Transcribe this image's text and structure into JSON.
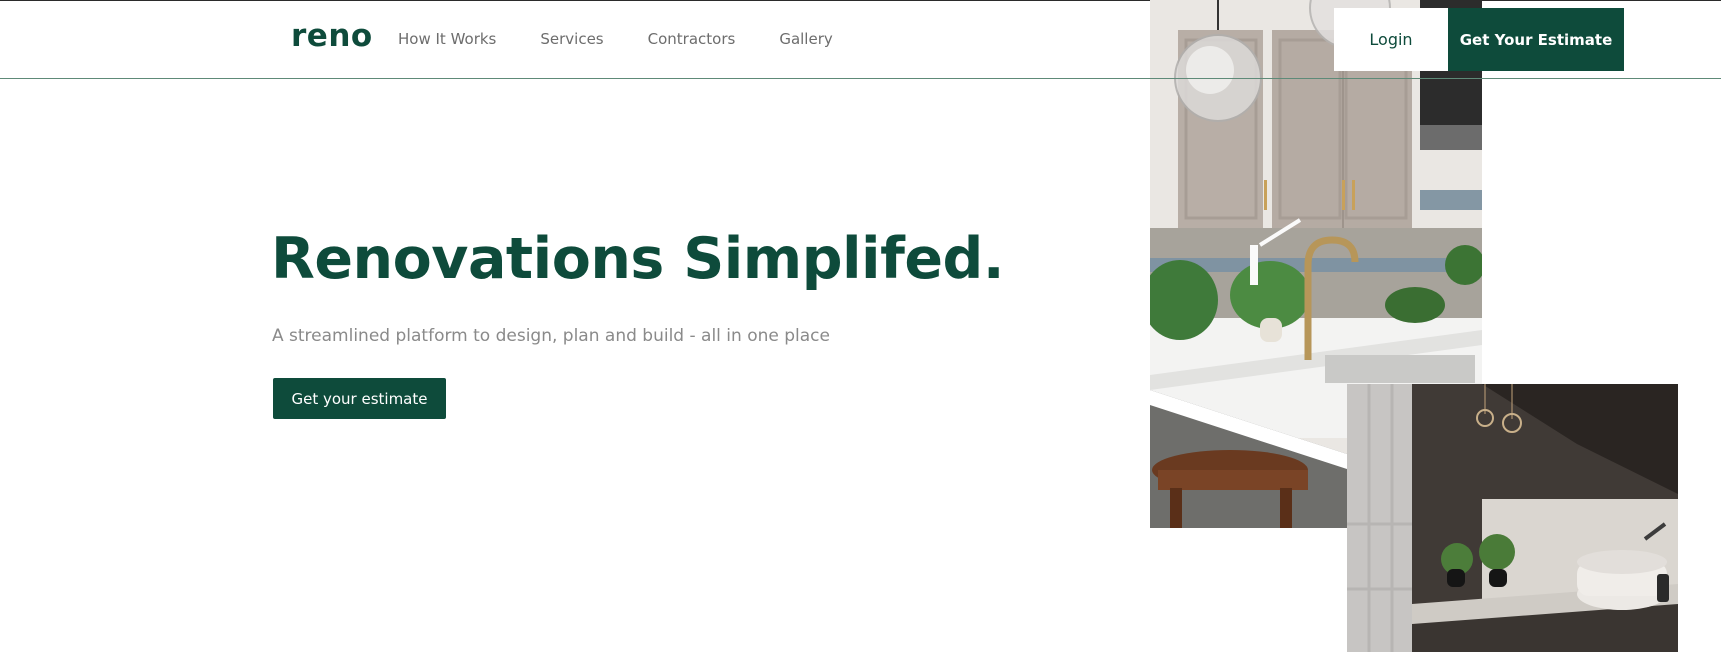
{
  "brand": {
    "logo": "reno",
    "primary_color": "#0e4b3b"
  },
  "nav": {
    "items": [
      "How It Works",
      "Services",
      "Contractors",
      "Gallery"
    ],
    "login_label": "Login",
    "cta_label": "Get Your Estimate"
  },
  "hero": {
    "title": "Renovations Simplifed.",
    "subtitle": "A streamlined platform to design, plan and build - all in one place",
    "button_label": "Get your estimate"
  },
  "images": {
    "kitchen_icon": "kitchen-photo",
    "bathroom_icon": "bathroom-photo"
  }
}
